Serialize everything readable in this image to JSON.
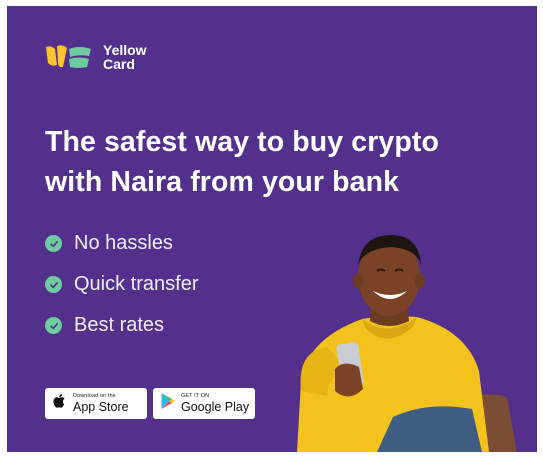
{
  "brand": {
    "name_line1": "Yellow",
    "name_line2": "Card",
    "logo_icon": "yellow-card-logo",
    "colors": {
      "yellow": "#f8c42f",
      "green": "#6fcba0"
    }
  },
  "headline": {
    "line1": "The safest way to buy crypto",
    "line2": "with Naira from your bank"
  },
  "features": [
    {
      "label": "No hassles",
      "icon": "check-circle-icon"
    },
    {
      "label": "Quick transfer",
      "icon": "check-circle-icon"
    },
    {
      "label": "Best rates",
      "icon": "check-circle-icon"
    }
  ],
  "stores": {
    "apple": {
      "small": "Download on the",
      "big": "App Store",
      "icon": "apple-icon"
    },
    "google": {
      "small": "GET IT ON",
      "big": "Google Play",
      "icon": "google-play-icon"
    }
  },
  "colors": {
    "background": "#53308c",
    "text": "#ffffff",
    "check": "#6fcba0"
  }
}
